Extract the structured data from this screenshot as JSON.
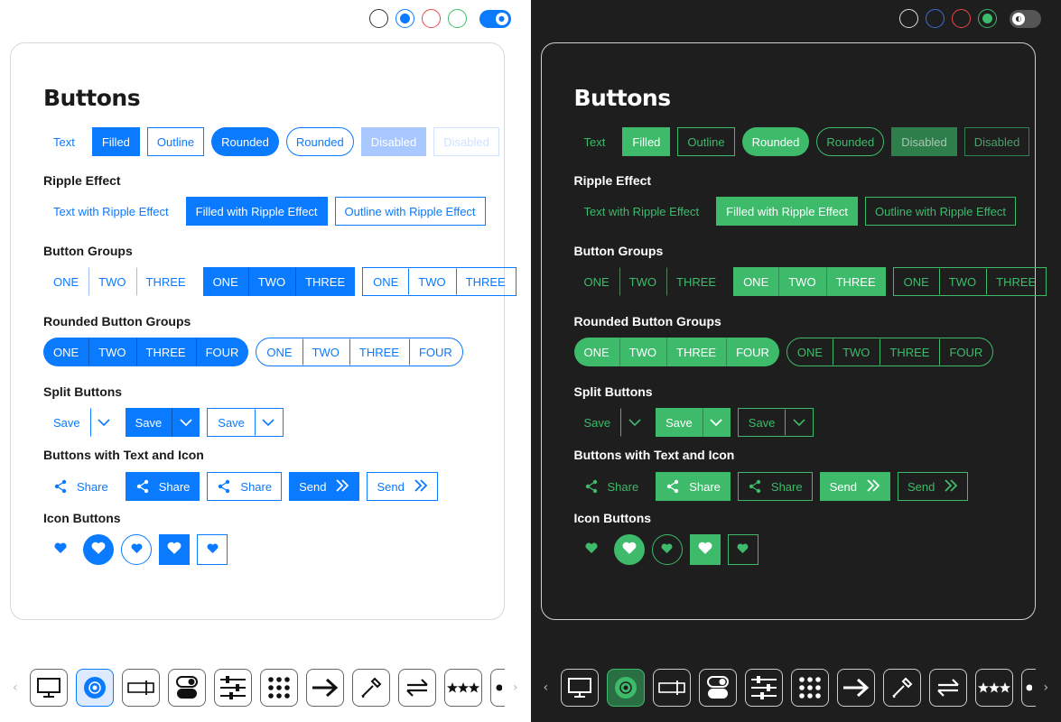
{
  "colors": {
    "light_accent": "#0a7aff",
    "dark_accent": "#3dbb6a",
    "theme_red": "#e64a4a",
    "theme_green": "#3dbb6a",
    "theme_blue": "#0a7aff"
  },
  "title": "Buttons",
  "sections": {
    "ripple": "Ripple Effect",
    "groups": "Button Groups",
    "rounded_groups": "Rounded Button Groups",
    "split": "Split Buttons",
    "text_icon": "Buttons with Text and Icon",
    "icon_buttons": "Icon Buttons"
  },
  "basic": {
    "text": "Text",
    "filled": "Filled",
    "outline": "Outline",
    "rounded_filled": "Rounded",
    "rounded_outline": "Rounded",
    "disabled_filled": "Disabled",
    "disabled_outline": "Disabled"
  },
  "ripple_buttons": {
    "text": "Text with Ripple Effect",
    "filled": "Filled with Ripple Effect",
    "outline": "Outline with Ripple Effect"
  },
  "group_labels": [
    "ONE",
    "TWO",
    "THREE"
  ],
  "rounded_group_labels": [
    "ONE",
    "TWO",
    "THREE",
    "FOUR"
  ],
  "split_label": "Save",
  "text_icon": {
    "share": "Share",
    "send": "Send"
  },
  "icons": {
    "tray": [
      "monitor-icon",
      "radio-icon",
      "text-field-icon",
      "toggle-icon",
      "sliders-icon",
      "grid-icon",
      "arrow-right-icon",
      "color-picker-icon",
      "swap-icon",
      "stars-icon",
      "partial-icon"
    ],
    "share": "share-icon",
    "send": "double-chevron-icon",
    "heart": "heart-icon"
  },
  "tray_nav": {
    "prev": "‹",
    "next": "›"
  }
}
